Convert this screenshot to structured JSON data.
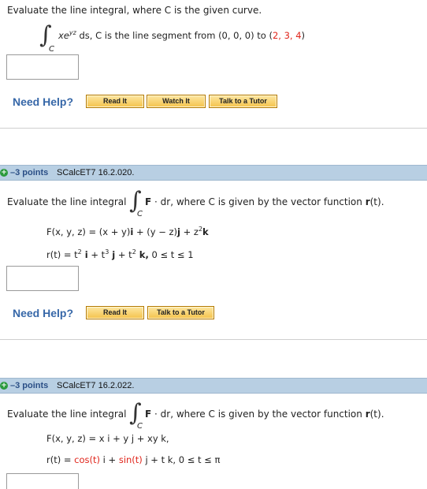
{
  "q1": {
    "prompt": "Evaluate the line integral, where C is the given curve.",
    "integral_sub": "C",
    "integrand": "xe",
    "integrand_exp": "yz",
    "integrand_rest": " ds,  C  is the line segment from  (0, 0, 0) to (",
    "endpoint": "2, 3, 4",
    "close_paren": ")",
    "need_help": "Need Help?",
    "read_it": "Read It",
    "watch_it": "Watch It",
    "talk_tutor": "Talk to a Tutor"
  },
  "q2": {
    "points": "–3 points",
    "ref": "SCalcET7 16.2.020.",
    "prompt_a": "Evaluate the line integral",
    "integral_sub": "C",
    "prompt_b_bold": "F",
    "prompt_b": " · dr,  where C is given by the vector function ",
    "prompt_b_vec": "r",
    "prompt_b_tail": "(t).",
    "F_def_pre": "F(x, y, z) = (x + y)",
    "F_def_i": "i",
    "F_def_mid": " + (y − z)",
    "F_def_j": "j",
    "F_def_plus": " + z",
    "F_def_exp": "2",
    "F_def_k": "k",
    "r_def_pre": "r(t) = t",
    "r_exp1": "2",
    "r_i": " i",
    "r_plus1": " + t",
    "r_exp2": "3",
    "r_j": " j",
    "r_plus2": " + t",
    "r_exp3": "2",
    "r_k": " k,",
    "r_range": "  0 ≤ t ≤ 1",
    "need_help": "Need Help?",
    "read_it": "Read It",
    "talk_tutor": "Talk to a Tutor"
  },
  "q3": {
    "points": "–3 points",
    "ref": "SCalcET7 16.2.022.",
    "prompt_a": "Evaluate the line integral",
    "integral_sub": "C",
    "prompt_b_bold": "F",
    "prompt_b": " · dr,  where C is given by the vector function ",
    "prompt_b_vec": "r",
    "prompt_b_tail": "(t).",
    "F_def": "F(x, y, z) = x i + y j + xy k,",
    "r_def_pre": "r(t) = ",
    "r_cos": "cos(t)",
    "r_i": " i + ",
    "r_sin": "sin(t)",
    "r_tail": " j + t k,  0 ≤ t ≤ π"
  },
  "colors": {
    "accent_red": "#e0251b",
    "help_blue": "#3667a8",
    "bar_blue": "#b8cfe3",
    "button_gold": "#f4c24b"
  }
}
